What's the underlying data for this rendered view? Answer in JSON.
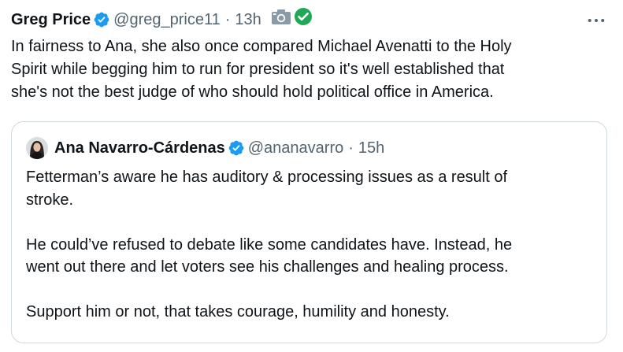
{
  "tweet": {
    "author_name": "Greg Price",
    "author_handle": "@greg_price11",
    "separator": "·",
    "time": "13h",
    "text": "In fairness to Ana, she also once compared Michael Avenatti to the Holy\nSpirit while begging him to run for president so it's well established that\nshe's not the best judge of who should hold political office in America.",
    "icons": {
      "verified": "verified-badge-icon",
      "camera": "camera-icon",
      "check": "green-check-icon",
      "more": "more-options-icon"
    }
  },
  "quote": {
    "author_name": "Ana Navarro-Cárdenas",
    "author_handle": "@ananavarro",
    "separator": "·",
    "time": "15h",
    "text": "Fetterman’s aware he has auditory & processing issues as a result of\nstroke.\n\nHe could’ve refused to debate like some candidates have. Instead, he\nwent out there and let voters see his challenges and healing process.\n\nSupport him or not, that takes courage, humility and honesty."
  },
  "colors": {
    "text_primary": "#0f1419",
    "text_secondary": "#536471",
    "verified_blue": "#1d9bf0",
    "check_green": "#1fa855",
    "border": "#cfd9de"
  }
}
